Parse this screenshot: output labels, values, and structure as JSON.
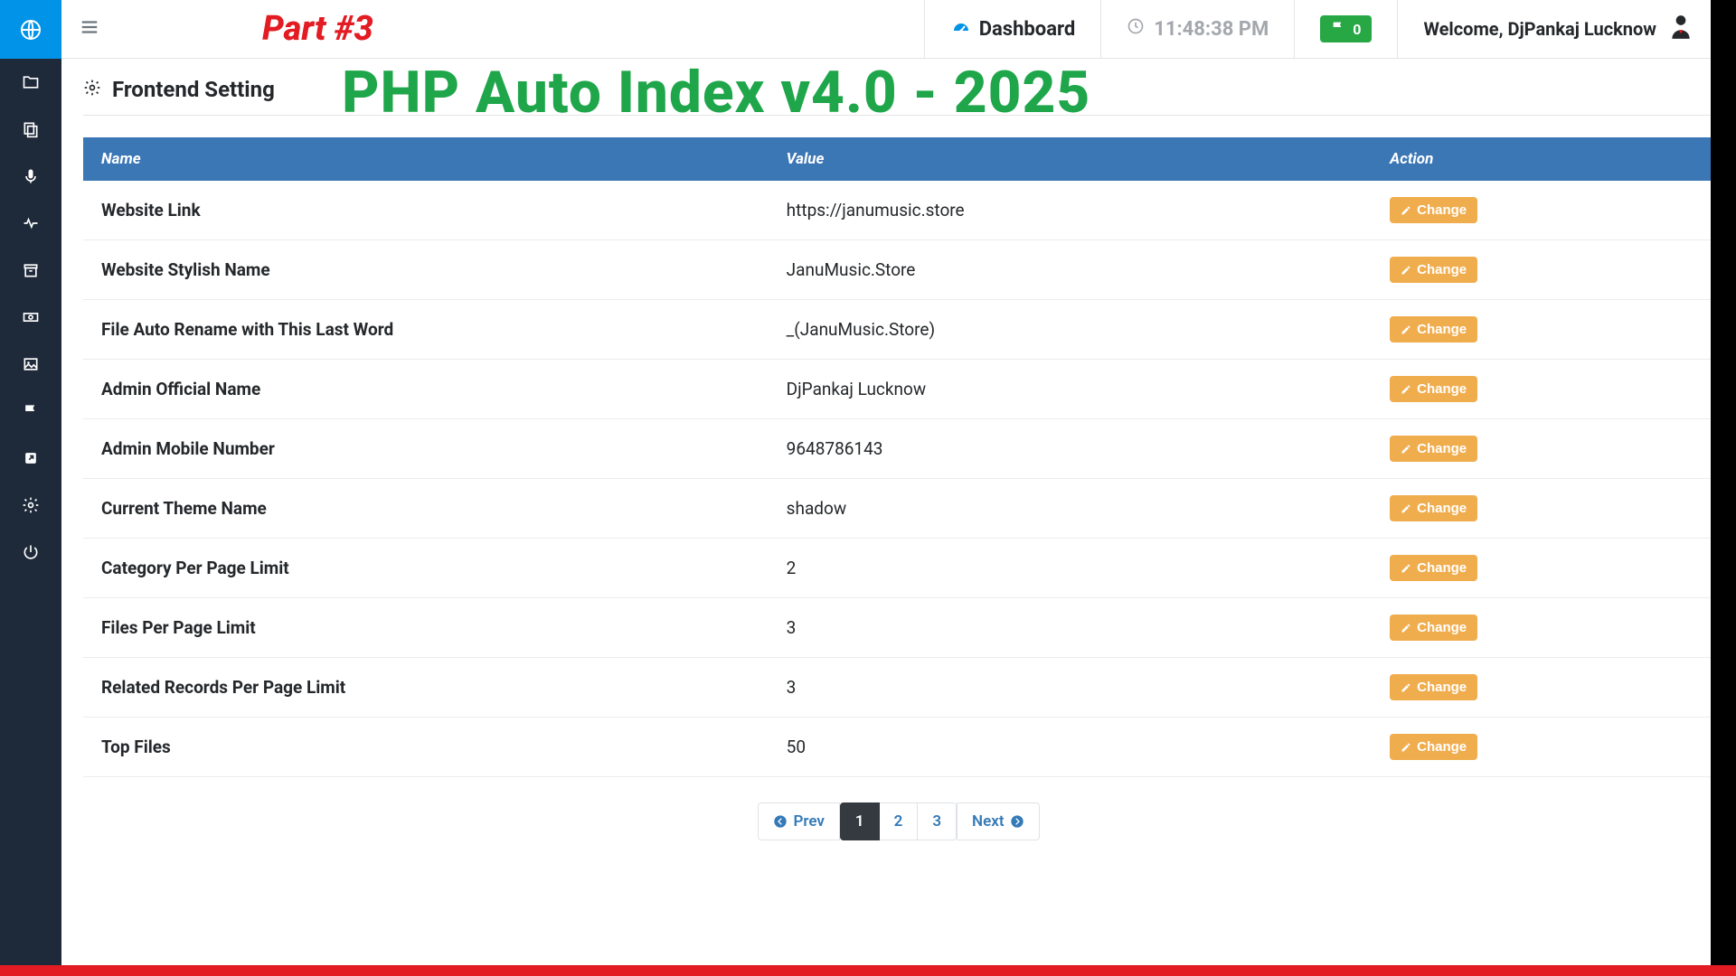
{
  "overlay": {
    "part_label": "Part #3",
    "banner": "PHP Auto Index v4.0 - 2025"
  },
  "topbar": {
    "dashboard_label": "Dashboard",
    "clock_time": "11:48:38 PM",
    "flag_count": "0",
    "welcome_text": "Welcome, DjPankaj Lucknow"
  },
  "page": {
    "title": "Frontend Setting"
  },
  "table": {
    "headers": {
      "name": "Name",
      "value": "Value",
      "action": "Action"
    },
    "change_label": "Change",
    "rows": [
      {
        "name": "Website Link",
        "value": "https://janumusic.store"
      },
      {
        "name": "Website Stylish Name",
        "value": "JanuMusic.Store"
      },
      {
        "name": "File Auto Rename with This Last Word",
        "value": "_(JanuMusic.Store)"
      },
      {
        "name": "Admin Official Name",
        "value": "DjPankaj Lucknow"
      },
      {
        "name": "Admin Mobile Number",
        "value": "9648786143"
      },
      {
        "name": "Current Theme Name",
        "value": "shadow"
      },
      {
        "name": "Category Per Page Limit",
        "value": "2"
      },
      {
        "name": "Files Per Page Limit",
        "value": "3"
      },
      {
        "name": "Related Records Per Page Limit",
        "value": "3"
      },
      {
        "name": "Top Files",
        "value": "50"
      }
    ]
  },
  "pagination": {
    "prev": "Prev",
    "next": "Next",
    "pages": [
      "1",
      "2",
      "3"
    ],
    "active": "1"
  }
}
